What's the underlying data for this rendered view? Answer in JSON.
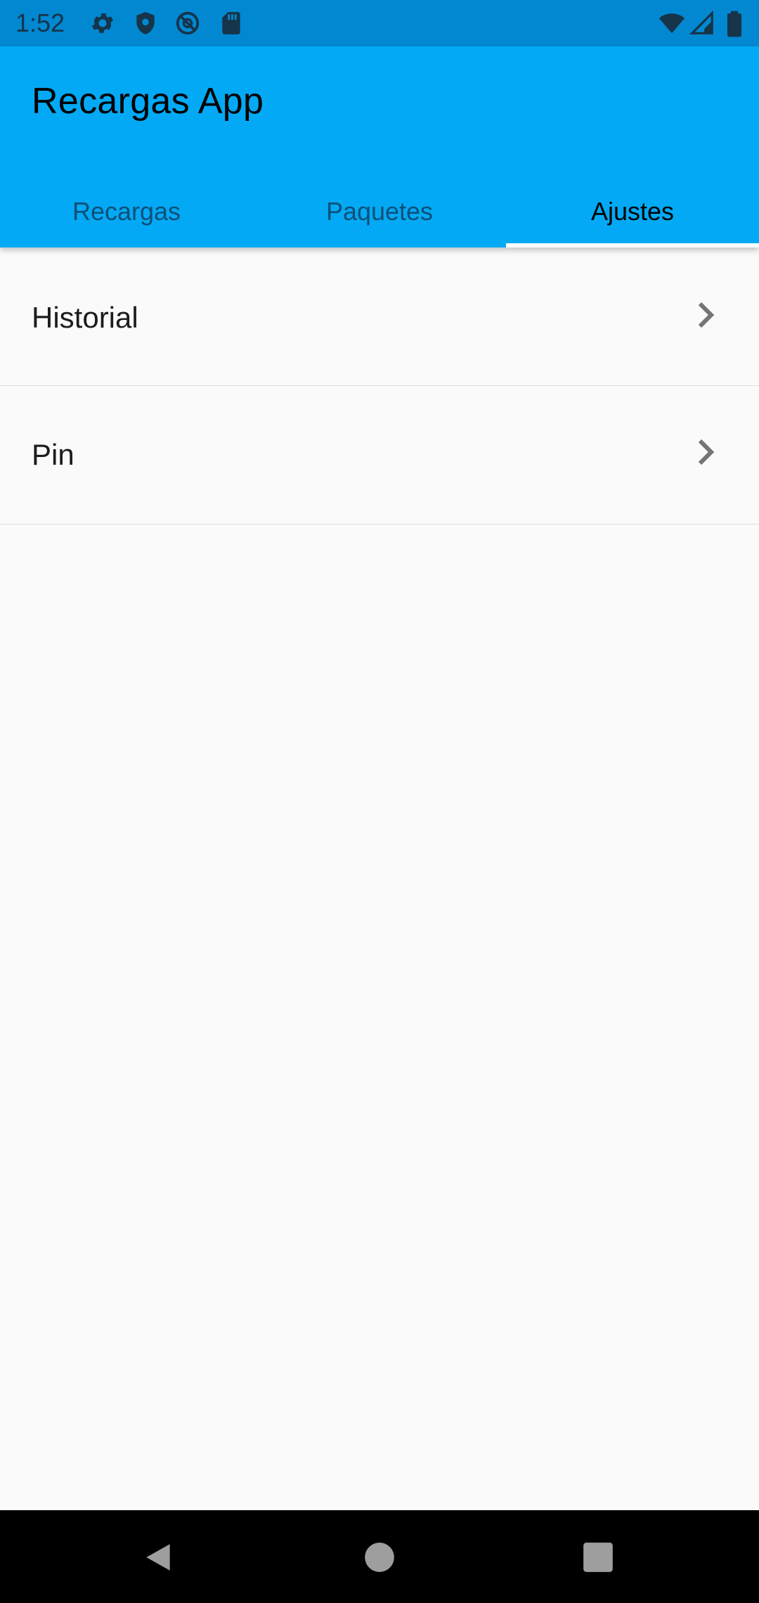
{
  "status_bar": {
    "time": "1:52",
    "left_icons": [
      "gear-icon",
      "shield-icon",
      "at-sign-icon",
      "sd-card-icon"
    ],
    "right_icons": [
      "wifi-icon",
      "cell-signal-icon",
      "battery-icon"
    ]
  },
  "app_bar": {
    "title": "Recargas App",
    "tabs": [
      {
        "label": "Recargas",
        "active": false
      },
      {
        "label": "Paquetes",
        "active": false
      },
      {
        "label": "Ajustes",
        "active": true
      }
    ]
  },
  "settings_list": {
    "items": [
      {
        "label": "Historial",
        "icon": "chevron-right-icon"
      },
      {
        "label": "Pin",
        "icon": "chevron-right-icon"
      }
    ]
  },
  "nav_bar": {
    "buttons": [
      "back-icon",
      "home-icon",
      "recents-icon"
    ]
  },
  "colors": {
    "status_bar_bg": "#0288d1",
    "app_bar_bg": "#03a9f4",
    "active_tab_text": "#000000",
    "inactive_tab_text": "#0e4f78",
    "indicator": "#ffffff",
    "background": "#fafafa"
  }
}
